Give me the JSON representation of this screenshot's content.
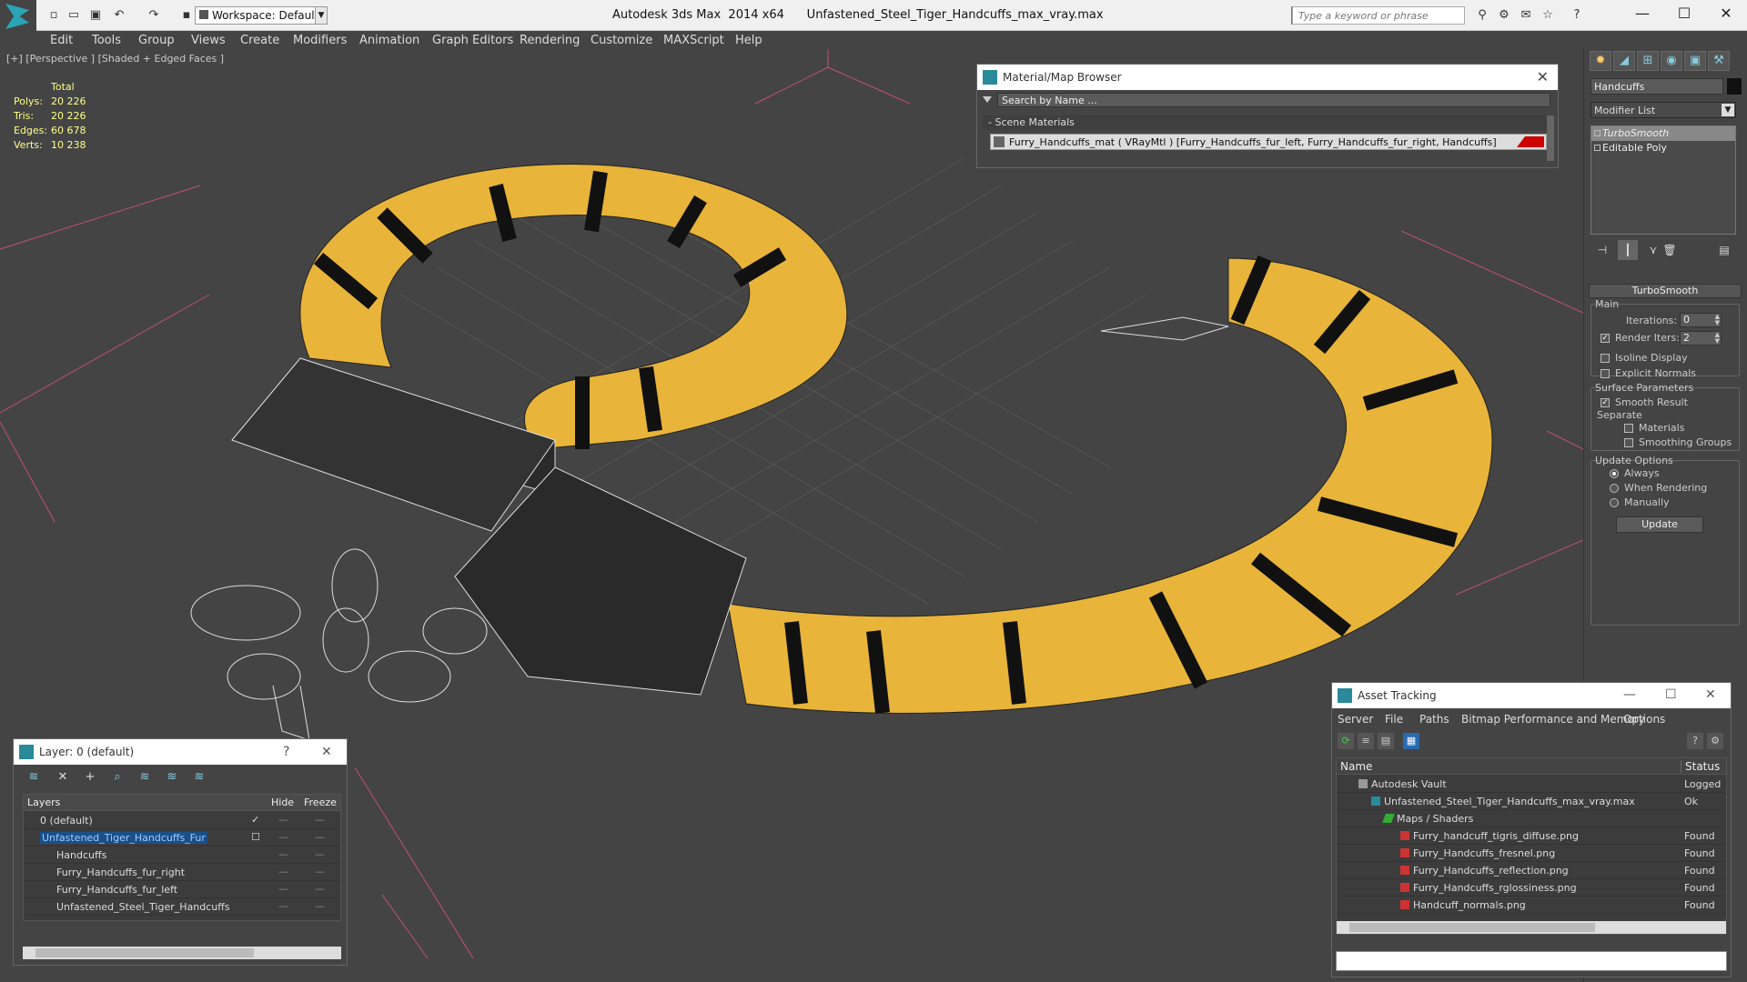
{
  "app": {
    "title": "Autodesk 3ds Max  2014 x64      Unfastened_Steel_Tiger_Handcuffs_max_vray.max",
    "workspace": "Workspace: Default",
    "search_placeholder": "Type a keyword or phrase"
  },
  "menu": [
    "Edit",
    "Tools",
    "Group",
    "Views",
    "Create",
    "Modifiers",
    "Animation",
    "Graph Editors",
    "Rendering",
    "Customize",
    "MAXScript",
    "Help"
  ],
  "viewport": {
    "label": "[+] [Perspective ] [Shaded + Edged Faces ]",
    "stats": {
      "header": "Total",
      "rows": [
        {
          "k": "Polys:",
          "v": "20 226"
        },
        {
          "k": "Tris:",
          "v": "20 226"
        },
        {
          "k": "Edges:",
          "v": "60 678"
        },
        {
          "k": "Verts:",
          "v": "10 238"
        }
      ]
    }
  },
  "material_browser": {
    "title": "Material/Map Browser",
    "search_placeholder": "Search by Name ...",
    "group": "- Scene Materials",
    "item": "Furry_Handcuffs_mat  ( VRayMtl ) [Furry_Handcuffs_fur_left, Furry_Handcuffs_fur_right, Handcuffs]"
  },
  "command_panel": {
    "object_name": "Handcuffs",
    "modifier_list": "Modifier List",
    "stack": [
      "TurboSmooth",
      "Editable Poly"
    ],
    "rollout_title": "TurboSmooth",
    "main_label": "Main",
    "iterations_label": "Iterations:",
    "iterations_value": "0",
    "render_iters_label": "Render Iters:",
    "render_iters_value": "2",
    "isoline": "Isoline Display",
    "explicit": "Explicit Normals",
    "surface_params": "Surface Parameters",
    "smooth_result": "Smooth Result",
    "separate": "Separate",
    "materials": "Materials",
    "smoothing_groups": "Smoothing Groups",
    "update_options": "Update Options",
    "always": "Always",
    "when_rendering": "When Rendering",
    "manually": "Manually",
    "update_button": "Update"
  },
  "layer_panel": {
    "title": "Layer: 0 (default)",
    "help": "?",
    "col_layers": "Layers",
    "col_hide": "Hide",
    "col_freeze": "Freeze",
    "rows": [
      {
        "name": "0 (default)",
        "indent": 1
      },
      {
        "name": "Unfastened_Tiger_Handcuffs_Fur",
        "indent": 1
      },
      {
        "name": "Handcuffs",
        "indent": 2
      },
      {
        "name": "Furry_Handcuffs_fur_right",
        "indent": 2
      },
      {
        "name": "Furry_Handcuffs_fur_left",
        "indent": 2
      },
      {
        "name": "Unfastened_Steel_Tiger_Handcuffs",
        "indent": 2
      }
    ]
  },
  "asset_tracking": {
    "title": "Asset Tracking",
    "menu": [
      "Server",
      "File",
      "Paths",
      "Bitmap Performance and Memory",
      "Options"
    ],
    "col_name": "Name",
    "col_status": "Status",
    "rows": [
      {
        "name": "Autodesk Vault",
        "status": "Logged",
        "indent": 1
      },
      {
        "name": "Unfastened_Steel_Tiger_Handcuffs_max_vray.max",
        "status": "Ok",
        "indent": 2
      },
      {
        "name": "Maps / Shaders",
        "status": "",
        "indent": 3
      },
      {
        "name": "Furry_handcuff_tigris_diffuse.png",
        "status": "Found",
        "indent": 4
      },
      {
        "name": "Furry_Handcuffs_fresnel.png",
        "status": "Found",
        "indent": 4
      },
      {
        "name": "Furry_Handcuffs_reflection.png",
        "status": "Found",
        "indent": 4
      },
      {
        "name": "Furry_Handcuffs_rglossiness.png",
        "status": "Found",
        "indent": 4
      },
      {
        "name": "Handcuff_normals.png",
        "status": "Found",
        "indent": 4
      }
    ]
  },
  "colors": {
    "fur_yellow": "#e8b43a",
    "stripe": "#111111",
    "selection": "#1b4f8a"
  }
}
